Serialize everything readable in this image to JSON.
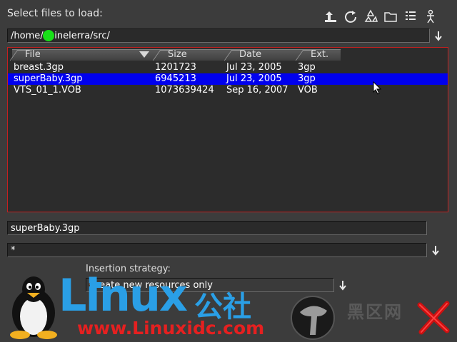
{
  "window": {
    "title": "Select files to load:"
  },
  "toolbar": {
    "buttons": [
      {
        "icon": "up-directory-icon"
      },
      {
        "icon": "refresh-icon"
      },
      {
        "icon": "recycle-icon"
      },
      {
        "icon": "new-folder-icon"
      },
      {
        "icon": "list-view-icon"
      },
      {
        "icon": "figure-icon"
      }
    ]
  },
  "path": {
    "value": "/home/     /cinelerra/src/"
  },
  "columns": [
    {
      "label": "File"
    },
    {
      "label": "Size"
    },
    {
      "label": "Date"
    },
    {
      "label": "Ext."
    }
  ],
  "files": [
    {
      "name": "breast.3gp",
      "size": "1201723",
      "date": "Jul 23, 2005",
      "ext": "3gp",
      "selected": false
    },
    {
      "name": "superBaby.3gp",
      "size": "6945213",
      "date": "Jul 23, 2005",
      "ext": "3gp",
      "selected": true
    },
    {
      "name": "VTS_01_1.VOB",
      "size": "1073639424",
      "date": "Sep 16, 2007",
      "ext": "VOB",
      "selected": false
    }
  ],
  "filename": {
    "value": "superBaby.3gp"
  },
  "filter": {
    "value": "*"
  },
  "insertion": {
    "label": "Insertion strategy:",
    "value": "Create new resources only"
  },
  "watermark": {
    "brand": "Linux",
    "brand_cn": "公社",
    "url": "www.Linuxidc.com",
    "cn_text": "黑区网"
  },
  "colors": {
    "selection": "#0000ee",
    "list_border": "#c42020",
    "logo_blue": "#2a9fe6",
    "logo_red": "#e52020"
  }
}
